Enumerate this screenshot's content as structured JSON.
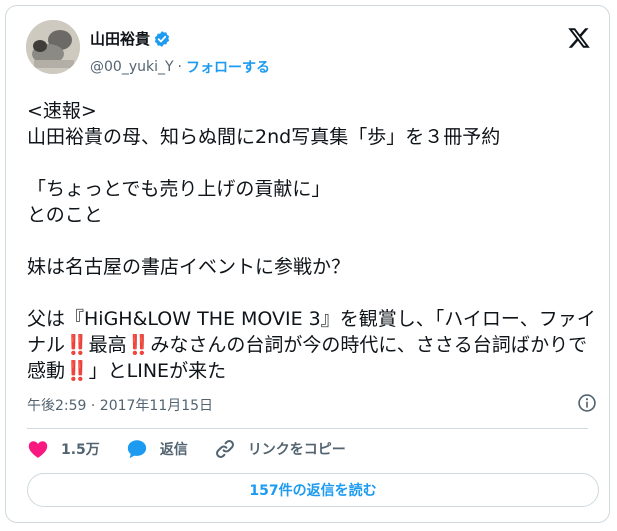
{
  "author": {
    "display_name": "山田裕貴",
    "handle": "@00_yuki_Y",
    "separator": "·",
    "follow_label": "フォローする"
  },
  "tweet": {
    "text": "<速報>\n山田裕貴の母、知らぬ間に2nd写真集「歩」を３冊予約\n\n「ちょっとでも売り上げの貢献に」\nとのこと\n\n妹は名古屋の書店イベントに参戦か？\n\n父は『HiGH&LOW THE MOVIE 3』を観賞し、「ハイロー、ファイナル‼️最高‼️みなさんの台詞が今の時代に、ささる台詞ばかりで感動‼️」とLINEが来た",
    "timestamp": "午後2:59 · 2017年11月15日"
  },
  "actions": {
    "likes_count": "1.5万",
    "reply_label": "返信",
    "copy_link_label": "リンクをコピー"
  },
  "read_replies_label": "157件の返信を読む",
  "icons": {
    "verified": "verified-badge-icon",
    "logo": "x-logo-icon",
    "info": "info-icon",
    "like": "heart-icon",
    "reply": "speech-bubble-icon",
    "link": "link-icon"
  },
  "colors": {
    "accent": "#1d9bf0",
    "like": "#f91880",
    "text": "#0f1419",
    "secondary": "#536471",
    "border": "#cfd9de"
  }
}
